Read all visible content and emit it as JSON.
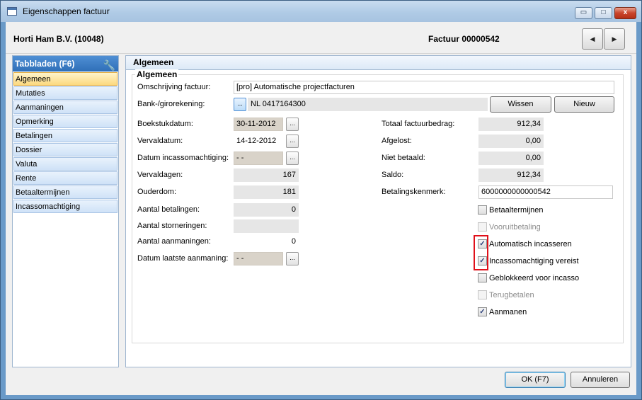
{
  "window": {
    "title": "Eigenschappen factuur",
    "min_glyph": "▭",
    "max_glyph": "□",
    "close_glyph": "x"
  },
  "header": {
    "company": "Horti Ham B.V. (10048)",
    "invoice": "Factuur 00000542",
    "prev_glyph": "◀",
    "next_glyph": "▶"
  },
  "sidebar": {
    "title": "Tabbladen (F6)",
    "items": [
      "Algemeen",
      "Mutaties",
      "Aanmaningen",
      "Opmerking",
      "Betalingen",
      "Dossier",
      "Valuta",
      "Rente",
      "Betaaltermijnen",
      "Incassomachtiging"
    ]
  },
  "main": {
    "title": "Algemeen",
    "group_title": "Algemeen"
  },
  "form": {
    "omschrijving_label": "Omschrijving factuur:",
    "omschrijving_value": "[pro] Automatische projectfacturen",
    "bank_label": "Bank-/girorekening:",
    "bank_value": "NL 0417164300",
    "wissen": "Wissen",
    "nieuw": "Nieuw",
    "boekstuk_label": "Boekstukdatum:",
    "boekstuk_value": "30-11-2012",
    "verval_label": "Vervaldatum:",
    "verval_value": "14-12-2012",
    "incasso_datum_label": "Datum incassomachtiging:",
    "incasso_datum_value": "- -",
    "vervaldagen_label": "Vervaldagen:",
    "vervaldagen_value": "167",
    "ouderdom_label": "Ouderdom:",
    "ouderdom_value": "181",
    "aantal_betalingen_label": "Aantal betalingen:",
    "aantal_betalingen_value": "0",
    "aantal_storneringen_label": "Aantal storneringen:",
    "aantal_storneringen_value": "",
    "aantal_aanmaningen_label": "Aantal aanmaningen:",
    "aantal_aanmaningen_value": "0",
    "laatste_aanmaning_label": "Datum laatste aanmaning:",
    "laatste_aanmaning_value": "- -",
    "totaal_label": "Totaal factuurbedrag:",
    "totaal_value": "912,34",
    "afgelost_label": "Afgelost:",
    "afgelost_value": "0,00",
    "niet_betaald_label": "Niet betaald:",
    "niet_betaald_value": "0,00",
    "saldo_label": "Saldo:",
    "saldo_value": "912,34",
    "kenmerk_label": "Betalingskenmerk:",
    "kenmerk_value": "6000000000000542",
    "ellipsis": "..."
  },
  "checkboxes": [
    {
      "label": "Betaaltermijnen",
      "checked": false,
      "disabled": false
    },
    {
      "label": "Vooruitbetaling",
      "checked": false,
      "disabled": true
    },
    {
      "label": "Automatisch incasseren",
      "checked": true,
      "disabled": false
    },
    {
      "label": "Incassomachtiging vereist",
      "checked": true,
      "disabled": false
    },
    {
      "label": "Geblokkeerd voor incasso",
      "checked": false,
      "disabled": false
    },
    {
      "label": "Terugbetalen",
      "checked": false,
      "disabled": true
    },
    {
      "label": "Aanmanen",
      "checked": true,
      "disabled": false
    }
  ],
  "check_glyph": "✓",
  "footer": {
    "ok": "OK (F7)",
    "cancel": "Annuleren"
  }
}
